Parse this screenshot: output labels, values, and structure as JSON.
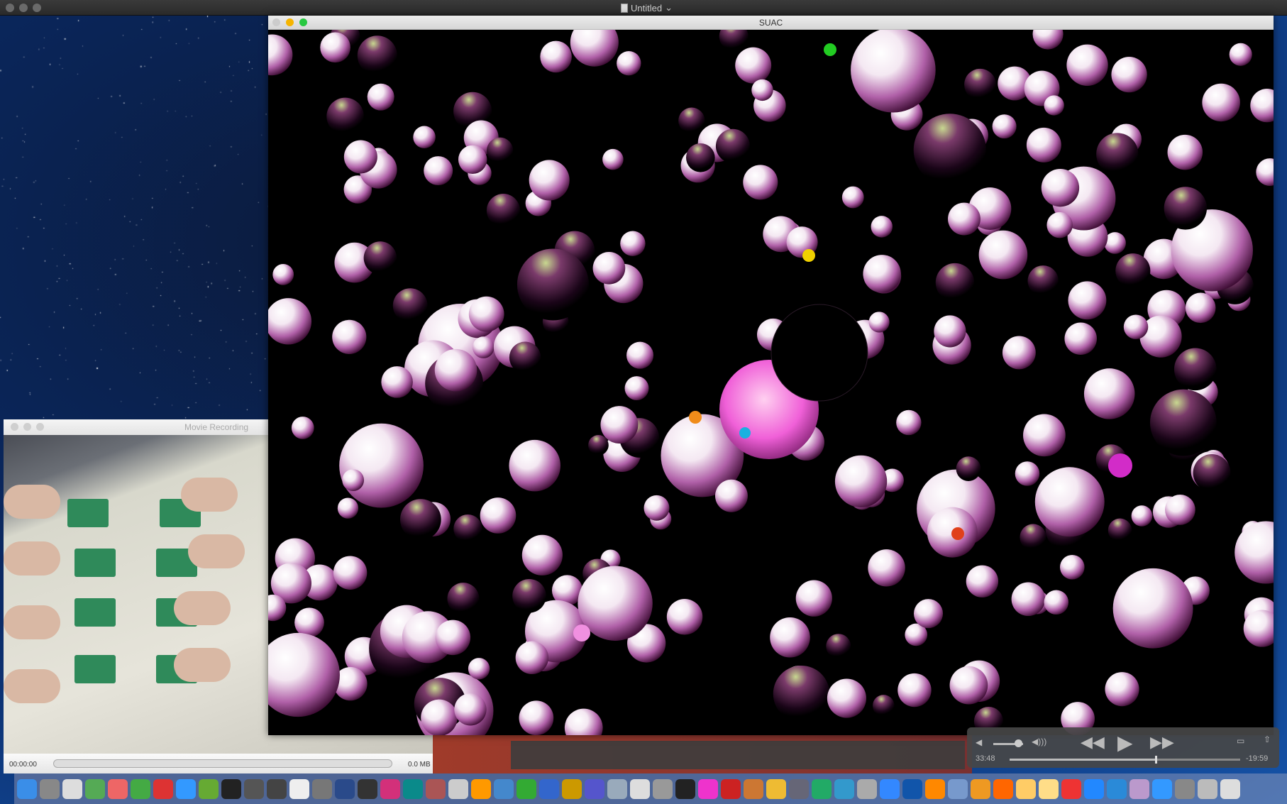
{
  "menubar": {
    "document_title": "Untitled"
  },
  "suac_window": {
    "title": "SUAC"
  },
  "movie_window": {
    "title": "Movie Recording",
    "elapsed": "00:00:00",
    "size": "0.0 MB"
  },
  "player": {
    "elapsed": "33:48",
    "remaining": "-19:59",
    "progress": 0.63,
    "volume": 0.85
  },
  "colors": {
    "accent_dots": [
      "#22cc22",
      "#f0d000",
      "#f08c1a",
      "#1ab0e0",
      "#d22cc8",
      "#e0401a",
      "#f090e0"
    ]
  },
  "dock": {
    "icons": [
      "finder",
      "launchpad",
      "notes",
      "evernote",
      "firefox",
      "chrome",
      "vivaldi",
      "safari",
      "bbedit",
      "terminal",
      "editor",
      "audio",
      "pd",
      "box",
      "processing",
      "pycharm",
      "p5",
      "arduino",
      "game",
      "spotlight",
      "airplane",
      "files",
      "prism",
      "triangle",
      "script",
      "books",
      "preview",
      "photos",
      "camera",
      "piano",
      "itunes",
      "flash",
      "guitar",
      "todo",
      "disk",
      "ftp",
      "home",
      "transmit",
      "app-store",
      "blue",
      "clapper",
      "quicktime",
      "ball",
      "vlc",
      "keynote",
      "pages",
      "mail",
      "zoom",
      "activity-monitor",
      "sound",
      "wifi",
      "settings",
      "photo-booth",
      "trash"
    ]
  }
}
